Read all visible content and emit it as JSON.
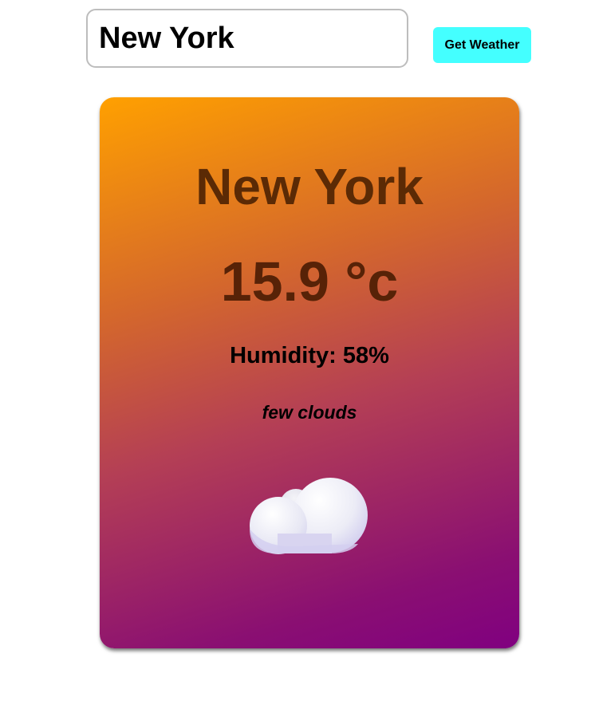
{
  "search": {
    "value": "New York",
    "button_label": "Get Weather"
  },
  "weather": {
    "city": "New York",
    "temperature": "15.9 °c",
    "humidity": "Humidity: 58%",
    "description": "few clouds",
    "icon": "cloud-icon"
  },
  "colors": {
    "button_accent": "#44ffff",
    "card_gradient_start": "#ffa000",
    "card_gradient_end": "#800080",
    "city_text": "#5b2a05",
    "temperature_text": "#572207"
  }
}
